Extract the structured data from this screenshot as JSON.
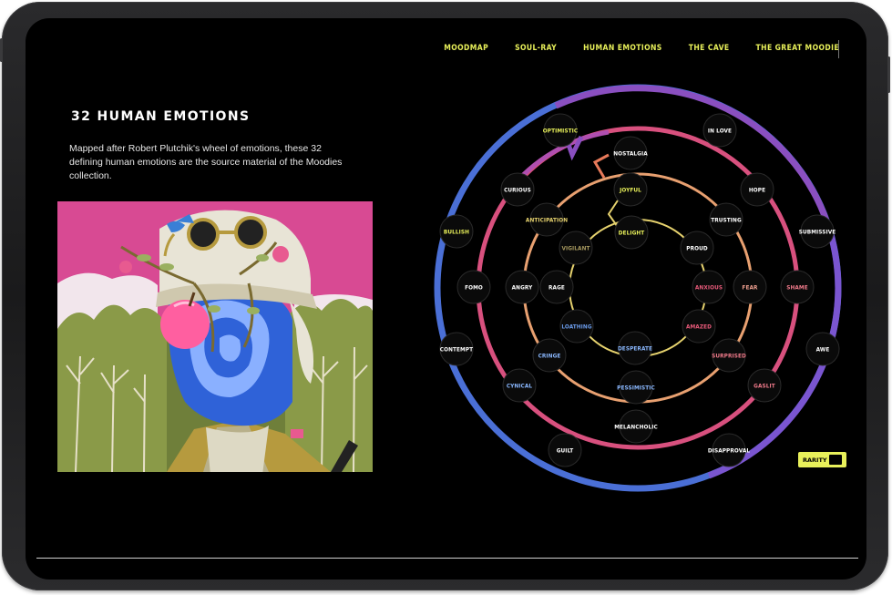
{
  "nav": {
    "items": [
      "MOODMAP",
      "SOUL-RAY",
      "HUMAN EMOTIONS",
      "THE CAVE",
      "THE GREAT MOODIE"
    ]
  },
  "page": {
    "title": "32 HUMAN EMOTIONS",
    "description": "Mapped after Robert Plutchik's wheel of emotions, these 32 defining human emotions are the source material of the Moodies collection."
  },
  "wheel": {
    "outer": [
      "OPTIMISTIC",
      "IN LOVE",
      "SUBMISSIVE",
      "AWE",
      "DISAPPROVAL",
      "GUILT",
      "CONTEMPT",
      "BULLISH"
    ],
    "ring2": [
      "CURIOUS",
      "NOSTALGIA",
      "HOPE",
      "SHAME",
      "GASLIT",
      "MELANCHOLIC",
      "CYNICAL",
      "FOMO"
    ],
    "ring3": [
      "ANTICIPATION",
      "JOYFUL",
      "TRUSTING",
      "FEAR",
      "SURPRISED",
      "PESSIMISTIC",
      "CRINGE",
      "ANGRY"
    ],
    "inner": [
      "VIGILANT",
      "DELIGHT",
      "PROUD",
      "ANXIOUS",
      "AMAZED",
      "DESPERATE",
      "LOATHING",
      "RAGE"
    ]
  },
  "rarity": {
    "label": "RARITY",
    "toggle_on": true
  },
  "colors": {
    "accent": "#e8f05a",
    "outer_ring_blue": "#4a6fd6",
    "outer_ring_purple": "#8a4fc0",
    "ring2_pink": "#d8507e",
    "ring3_orange": "#e8a070",
    "inner_yellow": "#e6d26e",
    "artwork_sky": "#d84a93",
    "artwork_face": "#2f62d8"
  },
  "icons": {
    "rarity_toggle": "toggle-switch-icon"
  }
}
